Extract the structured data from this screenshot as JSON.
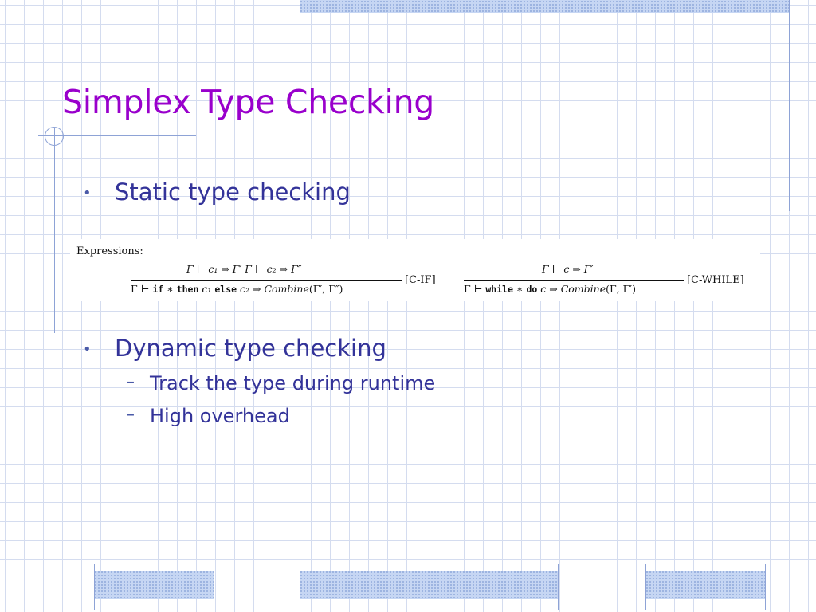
{
  "slide": {
    "title": "Simplex Type Checking",
    "bullets": [
      {
        "text": "Static type checking",
        "marker": "•"
      },
      {
        "text": "Dynamic type checking",
        "marker": "•"
      }
    ],
    "sub_bullets": [
      {
        "text": "Track the type during runtime",
        "marker": "–"
      },
      {
        "text": "High overhead",
        "marker": "–"
      }
    ]
  },
  "formula": {
    "label": "Expressions:",
    "rule_if": {
      "premise": "Γ ⊢ c₁ ⇒ Γ′   Γ ⊢ c₂ ⇒ Γ″",
      "conclusion_prefix": "Γ ⊢ ",
      "kw_if": "if",
      "star": " ∗ ",
      "kw_then": "then",
      "c1": " c₁ ",
      "kw_else": "else",
      "c2_arrow": " c₂ ⇒ ",
      "combine": "Combine",
      "args": "(Γ′, Γ″)",
      "name": "[C-IF]"
    },
    "rule_while": {
      "premise": "Γ ⊢ c ⇒ Γ′",
      "conclusion_prefix": "Γ ⊢ ",
      "kw_while": "while",
      "star": " ∗ ",
      "kw_do": "do",
      "c_arrow": " c ⇒ ",
      "combine": "Combine",
      "args": "(Γ, Γ′)",
      "name": "[C-WHILE]"
    }
  },
  "theme": {
    "title_color": "#9900cc",
    "text_color": "#333399",
    "grid_color": "#d4dcef",
    "accent_color": "#8ea3d6"
  }
}
